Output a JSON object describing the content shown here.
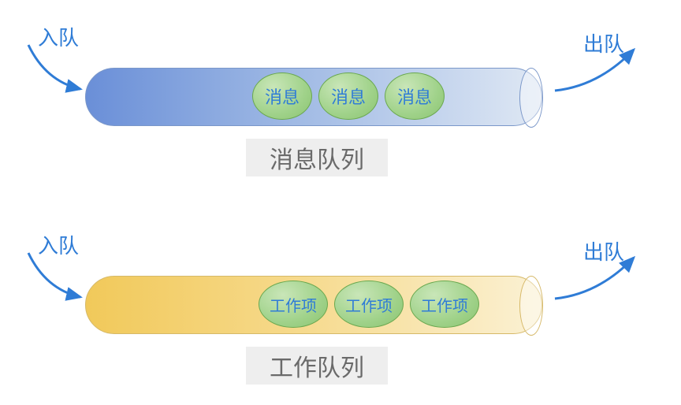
{
  "queues": [
    {
      "enqueue_label": "入队",
      "dequeue_label": "出队",
      "caption": "消息队列",
      "items": [
        "消息",
        "消息",
        "消息"
      ]
    },
    {
      "enqueue_label": "入队",
      "dequeue_label": "出队",
      "caption": "工作队列",
      "items": [
        "工作项",
        "工作项",
        "工作项"
      ]
    }
  ],
  "colors": {
    "text_blue": "#2f7cd6",
    "msg_tube": "#6a8fd8",
    "work_tube": "#f1c95a",
    "pellet_green": "#a0d28a"
  }
}
